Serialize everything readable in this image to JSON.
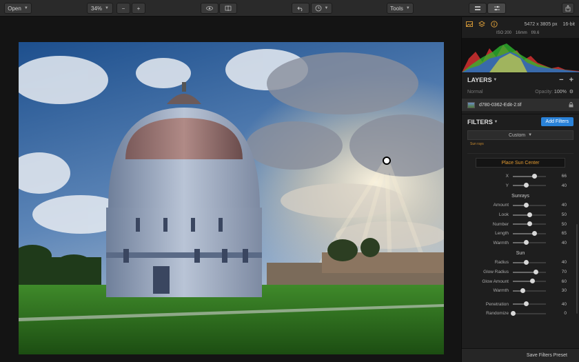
{
  "toolbar": {
    "open_label": "Open",
    "zoom_value": "34%",
    "tools_label": "Tools"
  },
  "panel": {
    "image_info": "16-bit",
    "dimensions": "5472 x 3805 px",
    "exif": {
      "iso": "ISO 200",
      "focal": "16mm",
      "aperture": "f/8.6"
    },
    "layers_title": "LAYERS",
    "blend_mode": "Normal",
    "opacity_label": "Opacity:",
    "opacity_value": "100%",
    "layer_name": "d780-0362-Edit-2.tif",
    "filters_title": "FILTERS",
    "add_filters_label": "Add Filters",
    "preset_label": "Custom",
    "filter_chip": "Sun rays",
    "place_sun_label": "Place Sun Center",
    "sunrays_title": "Sunrays",
    "sun_title": "Sun",
    "save_preset_label": "Save Filters Preset"
  },
  "sliders": {
    "position": [
      {
        "label": "X",
        "value": 66
      },
      {
        "label": "Y",
        "value": 40
      }
    ],
    "sunrays": [
      {
        "label": "Amount",
        "value": 40
      },
      {
        "label": "Look",
        "value": 50
      },
      {
        "label": "Number",
        "value": 50
      },
      {
        "label": "Length",
        "value": 65
      },
      {
        "label": "Warmth",
        "value": 40
      }
    ],
    "sun": [
      {
        "label": "Radius",
        "value": 40
      },
      {
        "label": "Glow Radius",
        "value": 70
      },
      {
        "label": "Glow Amount",
        "value": 60
      },
      {
        "label": "Warmth",
        "value": 30
      }
    ],
    "extra": [
      {
        "label": "Penetration",
        "value": 40
      },
      {
        "label": "Randomize",
        "value": 0
      }
    ]
  },
  "colors": {
    "accent": "#2a82d8",
    "tab_icon": "#e2a23a",
    "sun_button_text": "#e39b32"
  }
}
